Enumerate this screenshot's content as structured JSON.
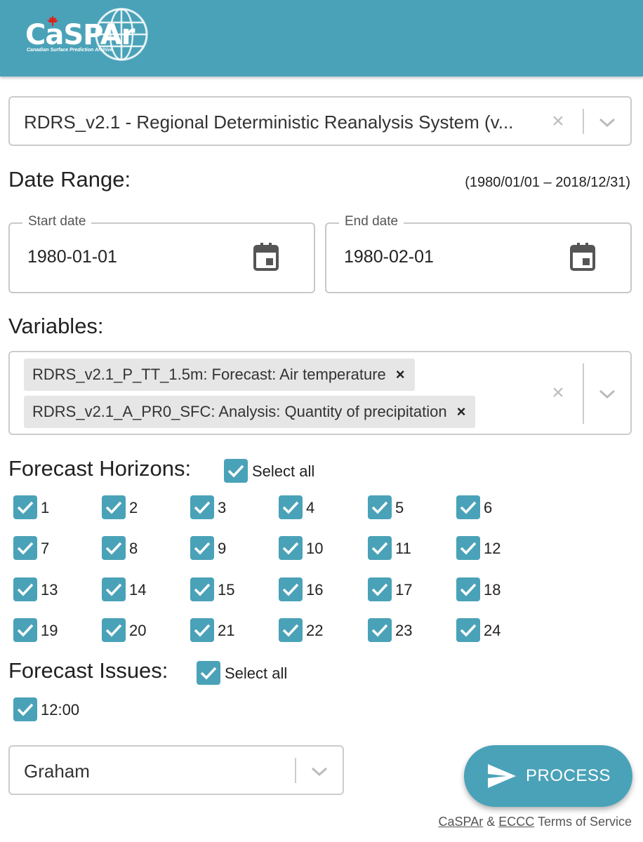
{
  "header": {
    "logo_text": "CaSPAr",
    "logo_subtitle": "Canadian Surface Prediction Archive",
    "bg_color": "#4aa2b8"
  },
  "dataset_select": {
    "value": "RDRS_v2.1 - Regional Deterministic Reanalysis System (v...",
    "clear_icon": "close-icon",
    "dropdown_icon": "chevron-down-icon"
  },
  "date_range": {
    "title": "Date Range:",
    "range_note": "(1980/01/01 – 2018/12/31)",
    "start": {
      "label": "Start date",
      "value": "1980-01-01",
      "icon": "calendar-icon"
    },
    "end": {
      "label": "End date",
      "value": "1980-02-01",
      "icon": "calendar-icon"
    }
  },
  "variables": {
    "title": "Variables:",
    "chips": [
      {
        "label": "RDRS_v2.1_P_TT_1.5m: Forecast: Air temperature",
        "remove": "×"
      },
      {
        "label": "RDRS_v2.1_A_PR0_SFC: Analysis: Quantity of precipitation",
        "remove": "×"
      }
    ]
  },
  "forecast_horizons": {
    "title": "Forecast Horizons:",
    "select_all": "Select all",
    "select_all_checked": true,
    "items": [
      "1",
      "2",
      "3",
      "4",
      "5",
      "6",
      "7",
      "8",
      "9",
      "10",
      "11",
      "12",
      "13",
      "14",
      "15",
      "16",
      "17",
      "18",
      "19",
      "20",
      "21",
      "22",
      "23",
      "24"
    ]
  },
  "forecast_issues": {
    "title": "Forecast Issues:",
    "select_all": "Select all",
    "select_all_checked": true,
    "items": [
      "12:00"
    ]
  },
  "server_select": {
    "value": "Graham",
    "dropdown_icon": "chevron-down-icon"
  },
  "process_button": {
    "label": "PROCESS",
    "icon": "send-icon",
    "color": "#4aa2b8"
  },
  "footer": {
    "link1": "CaSPAr",
    "amp": "&",
    "link2": "ECCC",
    "text": "Terms of Service"
  }
}
